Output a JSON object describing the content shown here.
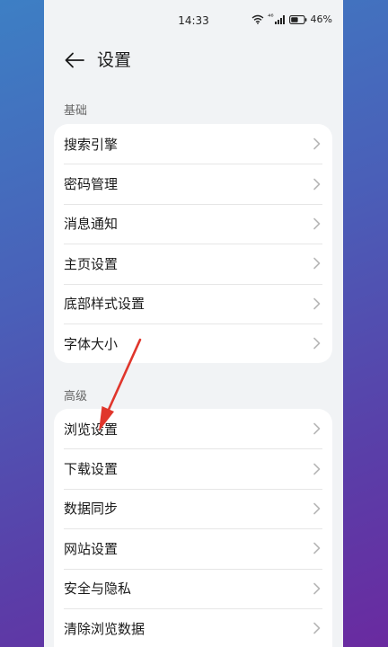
{
  "status": {
    "time": "14:33",
    "battery": "46%",
    "signal_tag": "⁴⁶"
  },
  "header": {
    "title": "设置"
  },
  "sections": [
    {
      "label": "基础",
      "items": [
        {
          "label": "搜索引擎"
        },
        {
          "label": "密码管理"
        },
        {
          "label": "消息通知"
        },
        {
          "label": "主页设置"
        },
        {
          "label": "底部样式设置"
        },
        {
          "label": "字体大小"
        }
      ]
    },
    {
      "label": "高级",
      "items": [
        {
          "label": "浏览设置"
        },
        {
          "label": "下载设置"
        },
        {
          "label": "数据同步"
        },
        {
          "label": "网站设置"
        },
        {
          "label": "安全与隐私"
        },
        {
          "label": "清除浏览数据"
        }
      ]
    }
  ],
  "colors": {
    "annotation_arrow": "#e0362c",
    "chevron": "#b8b8b8"
  }
}
